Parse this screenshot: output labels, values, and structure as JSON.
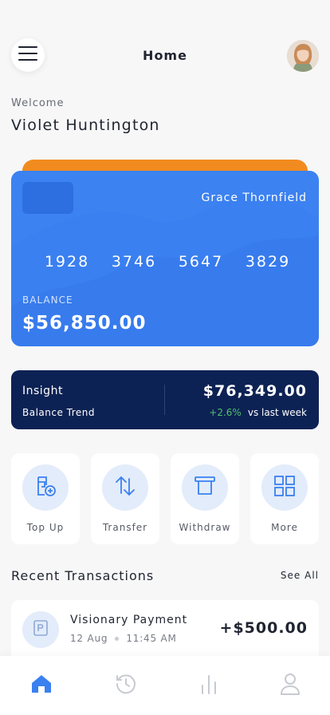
{
  "header": {
    "title": "Home"
  },
  "welcome": {
    "greeting": "Welcome",
    "name": "Violet Huntington"
  },
  "card": {
    "holder": "Grace Thornfield",
    "number_groups": [
      "1928",
      "3746",
      "5647",
      "3829"
    ],
    "balance_label": "BALANCE",
    "balance_value": "$56,850.00"
  },
  "insight": {
    "title": "Insight",
    "subtitle": "Balance Trend",
    "value": "$76,349.00",
    "change": "+2.6%",
    "change_suffix": "vs last week"
  },
  "actions": [
    {
      "label": "Top Up",
      "icon": "wallet-add-icon"
    },
    {
      "label": "Transfer",
      "icon": "transfer-arrows-icon"
    },
    {
      "label": "Withdraw",
      "icon": "withdraw-icon"
    },
    {
      "label": "More",
      "icon": "grid-icon"
    }
  ],
  "recent": {
    "title": "Recent Transactions",
    "see_all": "See All",
    "items": [
      {
        "name": "Visionary Payment",
        "date": "12 Aug",
        "time": "11:45 AM",
        "amount": "+$500.00"
      }
    ]
  },
  "nav": {
    "items": [
      {
        "icon": "home-icon",
        "active": true
      },
      {
        "icon": "history-icon",
        "active": false
      },
      {
        "icon": "stats-icon",
        "active": false
      },
      {
        "icon": "profile-icon",
        "active": false
      }
    ]
  },
  "colors": {
    "accent": "#3a80f0",
    "card_back": "#f28b1f",
    "insight_bg": "#0d2254",
    "positive": "#4fc26a"
  }
}
